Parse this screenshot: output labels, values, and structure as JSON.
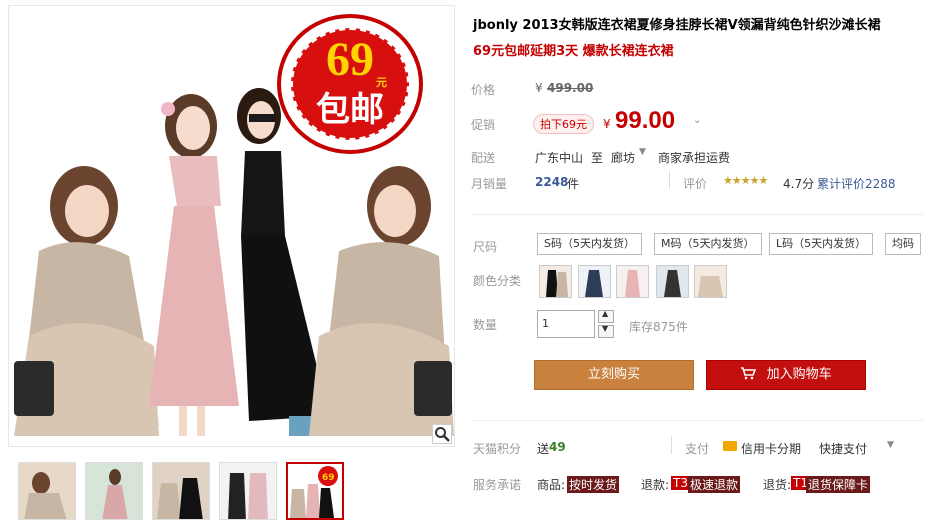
{
  "product": {
    "title": "jbonly 2013女韩版连衣裙夏修身挂脖长裙V领漏背纯色针织沙滩长裙",
    "subtitle": "69元包邮延期3天 爆款长裙连衣裙"
  },
  "badge": {
    "price": "69",
    "unit": "元",
    "text": "包邮"
  },
  "pricing": {
    "price_label": "价格",
    "original_price": "499.00",
    "yen": "¥",
    "promo_label": "促销",
    "promo_tag": "拍下69元",
    "current_price": "99.00"
  },
  "shipping": {
    "label": "配送",
    "from": "广东中山",
    "to_word": "至",
    "destination": "廊坊",
    "fee": "商家承担运费"
  },
  "sales": {
    "label": "月销量",
    "count": "2248",
    "unit": "件",
    "rating_label": "评价",
    "stars_value": 4.7,
    "stars_text": "★★★★★",
    "score": "4.7分",
    "total_reviews": "累计评价2288"
  },
  "size": {
    "label": "尺码",
    "options": [
      "S码（5天内发货）",
      "M码（5天内发货）",
      "L码（5天内发货）",
      "均码"
    ]
  },
  "color": {
    "label": "颜色分类"
  },
  "quantity": {
    "label": "数量",
    "value": "1",
    "stock": "库存875件"
  },
  "actions": {
    "buy_now": "立刻购买",
    "add_cart": "加入购物车"
  },
  "points": {
    "label": "天猫积分",
    "send": "送",
    "value": "49",
    "pay_label": "支付",
    "credit": "信用卡分期",
    "quick_pay": "快捷支付"
  },
  "service": {
    "label": "服务承诺",
    "items": [
      {
        "prefix": "商品:",
        "tag": "按时发货"
      },
      {
        "prefix": "退款:",
        "code": "T3",
        "tag": "极速退款"
      },
      {
        "prefix": "退货:",
        "code": "T1",
        "tag": "退货保障卡"
      }
    ]
  },
  "colors": {
    "accent": "#c40000",
    "buy": "#c9813e",
    "cart": "#c40f0f"
  }
}
